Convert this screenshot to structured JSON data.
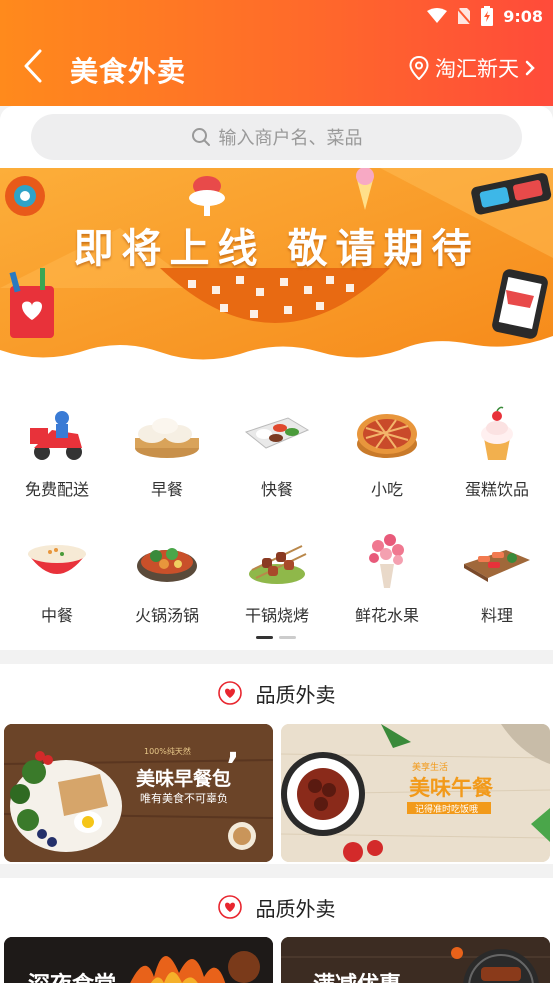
{
  "status": {
    "time": "9:08"
  },
  "header": {
    "title": "美食外卖",
    "location": "淘汇新天"
  },
  "search": {
    "placeholder": "输入商户名、菜品"
  },
  "banner": {
    "text": "即将上线 敬请期待"
  },
  "categories": [
    {
      "label": "免费配送",
      "icon": "delivery-scooter-icon"
    },
    {
      "label": "早餐",
      "icon": "steamed-buns-icon"
    },
    {
      "label": "快餐",
      "icon": "bento-tray-icon"
    },
    {
      "label": "小吃",
      "icon": "pie-icon"
    },
    {
      "label": "蛋糕饮品",
      "icon": "cupcake-icon"
    },
    {
      "label": "中餐",
      "icon": "congee-bowl-icon"
    },
    {
      "label": "火锅汤锅",
      "icon": "hotpot-icon"
    },
    {
      "label": "干锅烧烤",
      "icon": "skewers-icon"
    },
    {
      "label": "鲜花水果",
      "icon": "flower-bouquet-icon"
    },
    {
      "label": "料理",
      "icon": "sushi-board-icon"
    }
  ],
  "pager": {
    "count": 2,
    "active": 0
  },
  "sections": [
    {
      "title": "品质外卖",
      "promos": [
        {
          "title": "美味早餐包",
          "subtitle": "唯有美食不可辜负"
        },
        {
          "title": "美味午餐",
          "subtitle": "记得准时吃饭哦",
          "tag": "美享生活"
        }
      ]
    },
    {
      "title": "品质外卖",
      "promos": [
        {
          "title": "深夜食堂"
        },
        {
          "title": "满减优惠"
        }
      ]
    }
  ],
  "colors": {
    "primary": "#ff6a2a",
    "accent": "#e8262f",
    "banner": "#fb9a22"
  }
}
